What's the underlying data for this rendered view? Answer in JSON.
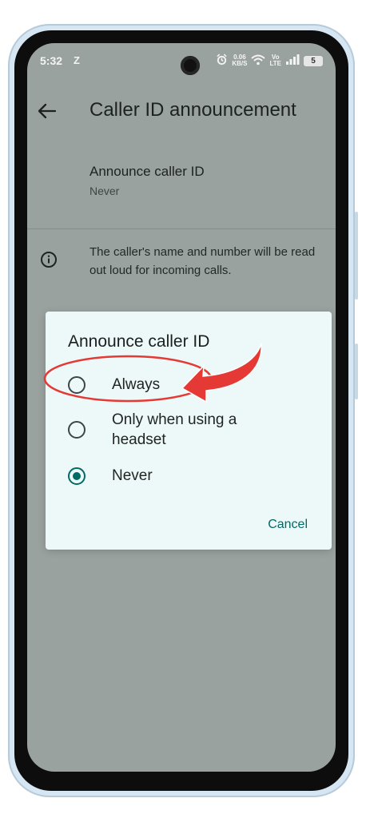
{
  "status_bar": {
    "time": "5:32",
    "indicator": "Z",
    "data_speed": "0.06",
    "data_unit": "KB/S",
    "network_top": "Vo",
    "network_bottom": "LTE",
    "battery": "5"
  },
  "app_bar": {
    "title": "Caller ID announcement",
    "back_icon": "back-arrow-icon"
  },
  "setting": {
    "title": "Announce caller ID",
    "value": "Never"
  },
  "info": {
    "icon": "info-icon",
    "text": "The caller's name and number will be read out loud for incoming calls."
  },
  "dialog": {
    "title": "Announce caller ID",
    "options": [
      {
        "label": "Always",
        "selected": false
      },
      {
        "label": "Only when using a headset",
        "selected": false
      },
      {
        "label": "Never",
        "selected": true
      }
    ],
    "cancel_label": "Cancel"
  },
  "colors": {
    "screen_scrim": "#9aa29f",
    "dialog_background": "#edf9f8",
    "accent": "#006a65",
    "annotation_red": "#e53935"
  }
}
